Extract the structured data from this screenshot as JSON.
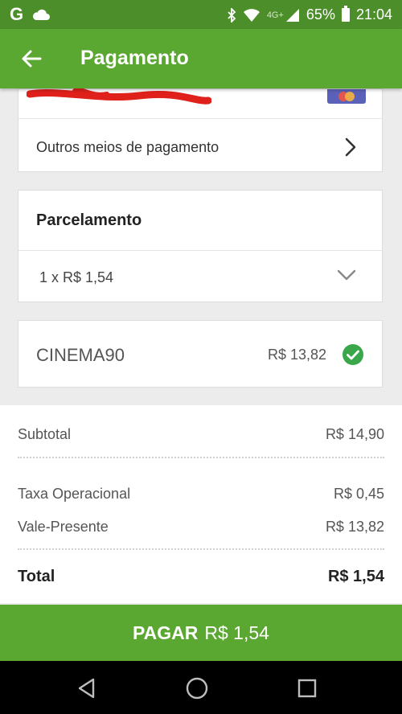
{
  "status_bar": {
    "time": "21:04",
    "battery": "65%",
    "network": "4G+",
    "left_icons": [
      "google-g-icon",
      "cloud-icon"
    ],
    "right_icons": [
      "bluetooth-icon",
      "wifi-icon",
      "signal-icon",
      "battery-icon"
    ],
    "g_text": "G"
  },
  "app_bar": {
    "title": "Pagamento",
    "color": "#5aa832"
  },
  "payment": {
    "other_methods_label": "Outros meios de pagamento"
  },
  "installments": {
    "title": "Parcelamento",
    "selected": "1 x R$ 1,54"
  },
  "coupon": {
    "code": "CINEMA90",
    "amount": "R$ 13,82",
    "status_color": "#3aa84a"
  },
  "summary": {
    "subtotal_label": "Subtotal",
    "subtotal_value": "R$ 14,90",
    "fee_label": "Taxa Operacional",
    "fee_value": "R$ 0,45",
    "gift_label": "Vale-Presente",
    "gift_value": "R$ 13,82",
    "total_label": "Total",
    "total_value": "R$ 1,54"
  },
  "pay_button": {
    "label": "PAGAR",
    "amount": "R$ 1,54"
  },
  "nav": {
    "icons": [
      "back-triangle-icon",
      "home-circle-icon",
      "recents-square-icon"
    ]
  }
}
